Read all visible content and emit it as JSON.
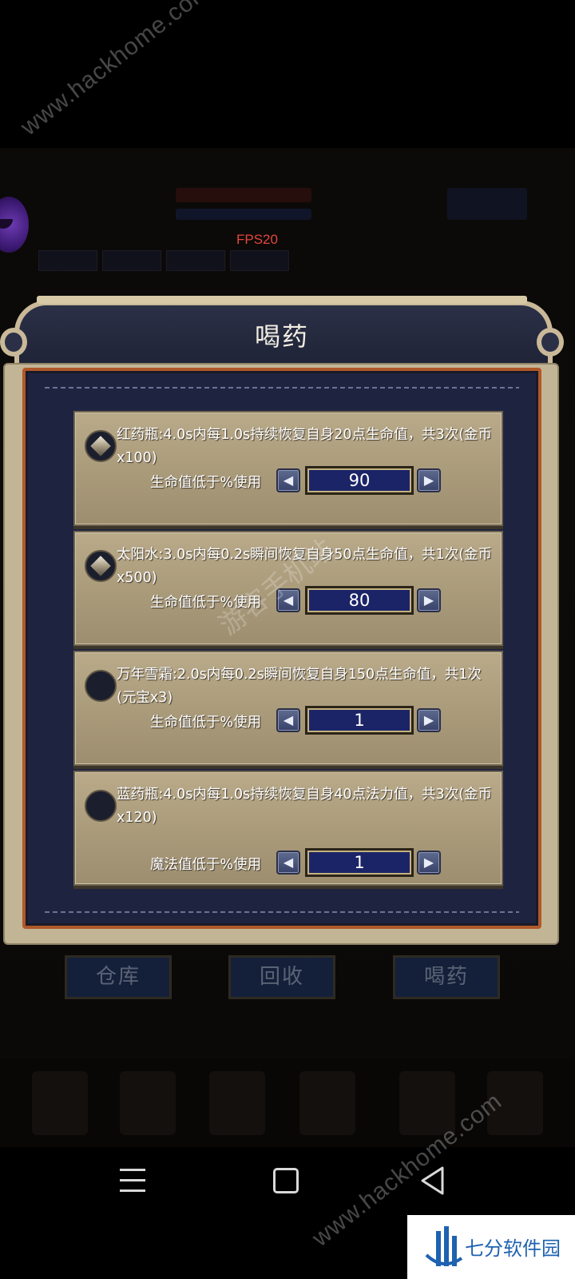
{
  "hud": {
    "fps": "FPS20"
  },
  "watermarks": {
    "site": "www.hackhome.com",
    "site_cn": "游客手机站"
  },
  "dialog": {
    "title": "喝药",
    "items": [
      {
        "icon": "diamond-gem-icon",
        "description": "红药瓶:4.0s内每1.0s持续恢复自身20点生命值，共3次(金币x100)",
        "label": "生命值低于%使用",
        "value": "90"
      },
      {
        "icon": "diamond-gem-icon",
        "description": "太阳水:3.0s内每0.2s瞬间恢复自身50点生命值，共1次(金币x500)",
        "label": "生命值低于%使用",
        "value": "80"
      },
      {
        "icon": "empty-slot-icon",
        "description": "万年雪霜:2.0s内每0.2s瞬间恢复自身150点生命值，共1次(元宝x3)",
        "label": "生命值低于%使用",
        "value": "1"
      },
      {
        "icon": "empty-slot-icon",
        "description": "蓝药瓶:4.0s内每1.0s持续恢复自身40点法力值，共3次(金币x120)",
        "label": "魔法值低于%使用",
        "value": "1"
      }
    ],
    "decrement_symbol": "◀",
    "increment_symbol": "▶"
  },
  "bottom_buttons": [
    "仓库",
    "回收",
    "喝药"
  ],
  "logo": {
    "text": "七分软件园"
  },
  "colors": {
    "value_box": "#1c2468",
    "frame_accent": "#b0582a",
    "fps": "#e2463d"
  }
}
